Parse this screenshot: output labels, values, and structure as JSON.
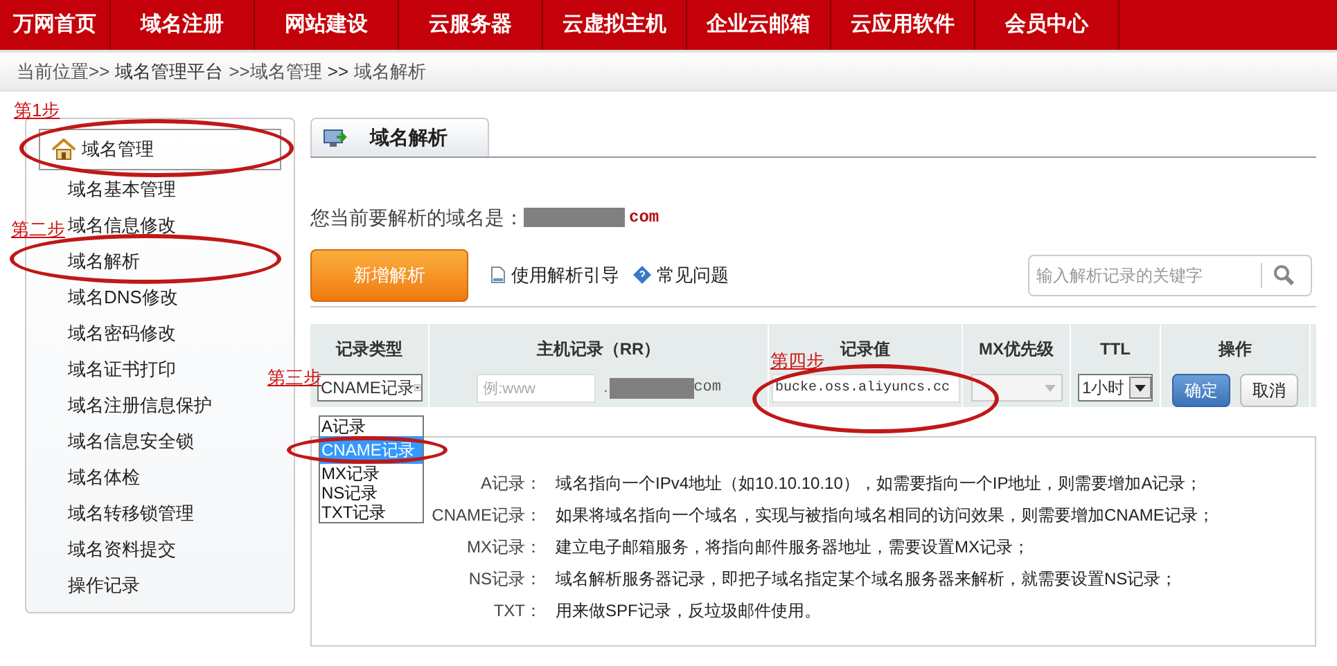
{
  "nav": {
    "items": [
      {
        "label": "万网首页"
      },
      {
        "label": "域名注册"
      },
      {
        "label": "网站建设"
      },
      {
        "label": "云服务器"
      },
      {
        "label": "云虚拟主机"
      },
      {
        "label": "企业云邮箱"
      },
      {
        "label": "云应用软件"
      },
      {
        "label": "会员中心"
      }
    ]
  },
  "breadcrumb": [
    "当前位置>>",
    "域名管理平台",
    ">>域名管理",
    ">>",
    "域名解析"
  ],
  "steps": [
    "第1步",
    "第二步",
    "第三步",
    "第四步"
  ],
  "sidebar": {
    "header": "域名管理",
    "items": [
      "域名基本管理",
      "域名信息修改",
      "域名解析",
      "域名DNS修改",
      "域名密码修改",
      "域名证书打印",
      "域名注册信息保护",
      "域名信息安全锁",
      "域名体检",
      "域名转移锁管理",
      "域名资料提交",
      "操作记录"
    ]
  },
  "tab": {
    "label": "域名解析"
  },
  "domain_line": {
    "label": "您当前要解析的域名是：",
    "suffix": "com"
  },
  "toolbar": {
    "add_button": "新增解析",
    "guide_link": "使用解析引导",
    "faq_link": "常见问题",
    "search_placeholder": "输入解析记录的关键字"
  },
  "table": {
    "columns": [
      "记录类型",
      "主机记录（RR）",
      "记录值",
      "MX优先级",
      "TTL",
      "操作"
    ],
    "row": {
      "type_value": "CNAME记录",
      "host_placeholder": "例:www",
      "host_separator": ".",
      "host_suffix": "com",
      "record_value": "bucke.oss.aliyuncs.cc",
      "mx_disabled": true,
      "ttl": "1小时",
      "confirm": "确定",
      "cancel": "取消"
    },
    "type_options": [
      {
        "label": "A记录",
        "selected": false
      },
      {
        "label": "CNAME记录",
        "selected": true
      },
      {
        "label": "MX记录",
        "selected": false
      },
      {
        "label": "NS记录",
        "selected": false
      },
      {
        "label": "TXT记录",
        "selected": false
      }
    ]
  },
  "help": [
    {
      "term": "A记录：",
      "text": "域名指向一个IPv4地址（如10.10.10.10），如需要指向一个IP地址，则需要增加A记录；"
    },
    {
      "term": "CNAME记录：",
      "text": "如果将域名指向一个域名，实现与被指向域名相同的访问效果，则需要增加CNAME记录；"
    },
    {
      "term": "MX记录：",
      "text": "建立电子邮箱服务，将指向邮件服务器地址，需要设置MX记录；"
    },
    {
      "term": "NS记录：",
      "text": "域名解析服务器记录，即把子域名指定某个域名服务器来解析，就需要设置NS记录；"
    },
    {
      "term": "TXT：",
      "text": "用来做SPF记录，反垃圾邮件使用。"
    }
  ]
}
